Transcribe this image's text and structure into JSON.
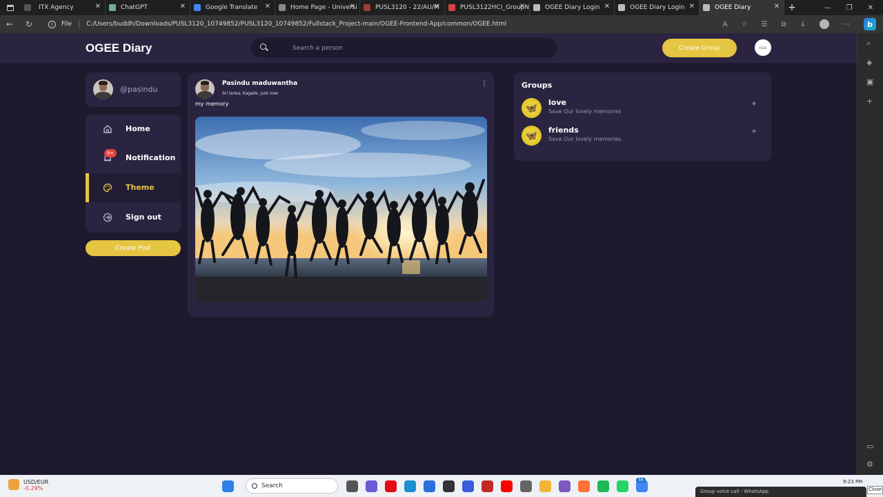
{
  "browser": {
    "tabs": [
      {
        "title": "ITX Agency",
        "color": "#555555",
        "active": false
      },
      {
        "title": "ChatGPT",
        "color": "#74aa9c",
        "active": false
      },
      {
        "title": "Google Translate",
        "color": "#4285f4",
        "active": false
      },
      {
        "title": "Home Page - Universi",
        "color": "#888888",
        "active": false
      },
      {
        "title": "PUSL3120 - 22/AU/M",
        "color": "#a33a3a",
        "active": false
      },
      {
        "title": "PUSL3122HCI_GroupN",
        "color": "#d94040",
        "active": false
      },
      {
        "title": "OGEE Diary Login",
        "color": "#bbbbbb",
        "active": false
      },
      {
        "title": "OGEE Diary Login",
        "color": "#bbbbbb",
        "active": false
      },
      {
        "title": "OGEE Diary",
        "color": "#bbbbbb",
        "active": true
      }
    ],
    "new_tab_icon": "plus-icon",
    "file_label": "File",
    "url": "C:/Users/buddh/Downloads/PUSL3120_10749852/PUSL3120_10749852/Fullstack_Project-main/OGEE-Frontend-App/common/OGEE.html",
    "bing_label": "b"
  },
  "header": {
    "logo": "OGEE Diary",
    "search_placeholder": "Search a person",
    "create_group_label": "Create Group",
    "avatar_text": "OGEE"
  },
  "profile": {
    "handle": "@pasindu"
  },
  "menu": {
    "items": [
      {
        "label": "Home",
        "icon": "home-icon",
        "active": false
      },
      {
        "label": "Notification",
        "icon": "bell-icon",
        "active": false,
        "badge": "9+"
      },
      {
        "label": "Theme",
        "icon": "palette-icon",
        "active": true
      },
      {
        "label": "Sign out",
        "icon": "sign-out-icon",
        "active": false
      }
    ],
    "create_post_label": "Create Post"
  },
  "post": {
    "author": "Pasindu maduwantha",
    "meta": "Sri lanka, Kagalle, just now",
    "caption": "my memory",
    "more_icon": "more-vertical-icon",
    "image_subject": "friends-jumping-sunset-beach"
  },
  "groups": {
    "title": "Groups",
    "items": [
      {
        "name": "love",
        "description": "Save Our lovely memories",
        "icon": "butterfly-icon"
      },
      {
        "name": "friends",
        "description": "Save Our lovely memories",
        "icon": "butterfly-icon"
      }
    ]
  },
  "taskbar": {
    "ticker_label": "USD/EUR",
    "ticker_change": "-0.29%",
    "search_label": "Search",
    "badge": "56",
    "time": "9:23 PM",
    "toast": "Group voice call - WhatsApp",
    "close_tip": "Close"
  },
  "colors": {
    "accent": "#e5c542",
    "background": "#1d1a2e",
    "card": "#2b2440",
    "badge": "#e0433f"
  }
}
